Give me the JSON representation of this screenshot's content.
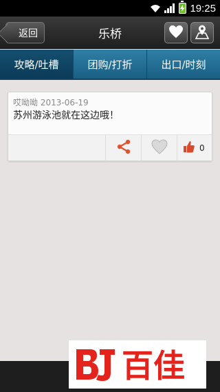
{
  "status_bar": {
    "time": "19:25"
  },
  "header": {
    "back_label": "返回",
    "title": "乐桥"
  },
  "tabs": [
    {
      "label": "攻略/吐槽",
      "active": true
    },
    {
      "label": "团购/打折",
      "active": false
    },
    {
      "label": "出口/时刻",
      "active": false
    }
  ],
  "post": {
    "author": "哎呦呦",
    "date": "2013-06-19",
    "text": "苏州游泳池就在这边哦！",
    "like_count": "0"
  },
  "icons": {
    "fav": "heart-icon",
    "map": "map-pin-icon",
    "share": "share-icon",
    "like": "thumbs-up-icon"
  },
  "colors": {
    "tab_bar": "#2f7fa5",
    "tab_active": "#0b3b57",
    "share_accent": "#e0532f",
    "logo_red": "#e4231d"
  },
  "logo": {
    "text": "百佳",
    "mark": "BJ"
  }
}
